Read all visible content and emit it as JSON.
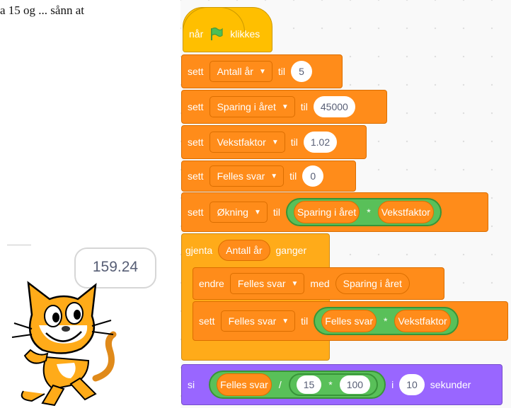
{
  "stage": {
    "top_text": "a 15 og ... sånn at",
    "bubble_value": "159.24"
  },
  "blocks": {
    "hat": {
      "left": "når",
      "right": "klikkes"
    },
    "set1": {
      "verb": "sett",
      "var": "Antall år",
      "to": "til",
      "value": "5"
    },
    "set2": {
      "verb": "sett",
      "var": "Sparing i året",
      "to": "til",
      "value": "45000"
    },
    "set3": {
      "verb": "sett",
      "var": "Vekstfaktor",
      "to": "til",
      "value": "1.02"
    },
    "set4": {
      "verb": "sett",
      "var": "Felles svar",
      "to": "til",
      "value": "0"
    },
    "set5": {
      "verb": "sett",
      "var": "Økning",
      "to": "til",
      "left": "Sparing i året",
      "op": "*",
      "right": "Vekstfaktor"
    },
    "repeat": {
      "verb": "gjenta",
      "arg": "Antall år",
      "suffix": "ganger"
    },
    "change": {
      "verb": "endre",
      "var": "Felles svar",
      "by": "med",
      "value": "Sparing i året"
    },
    "set6": {
      "verb": "sett",
      "var": "Felles svar",
      "to": "til",
      "left": "Felles svar",
      "op": "*",
      "right": "Vekstfaktor"
    },
    "say": {
      "verb": "si",
      "left": "Felles svar",
      "op_div": "/",
      "n1": "15",
      "op_mul": "*",
      "n2": "100",
      "mid": "i",
      "secs": "10",
      "suffix": "sekunder"
    }
  },
  "colors": {
    "events": "#ffbf00",
    "variables": "#ff8c1a",
    "control": "#ffab19",
    "operators": "#59c059",
    "looks": "#9966ff"
  }
}
